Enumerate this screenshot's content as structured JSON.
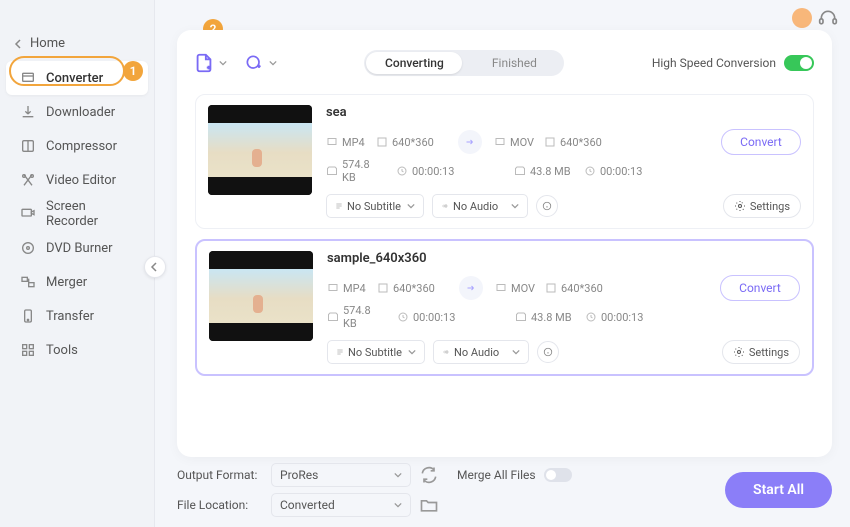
{
  "home_label": "Home",
  "sidebar": [
    {
      "label": "Converter",
      "active": true
    },
    {
      "label": "Downloader"
    },
    {
      "label": "Compressor"
    },
    {
      "label": "Video Editor"
    },
    {
      "label": "Screen Recorder"
    },
    {
      "label": "DVD Burner"
    },
    {
      "label": "Merger"
    },
    {
      "label": "Transfer"
    },
    {
      "label": "Tools"
    }
  ],
  "callout": {
    "one": "1",
    "two": "2"
  },
  "tabs": {
    "converting": "Converting",
    "finished": "Finished"
  },
  "hsc": {
    "label": "High Speed Conversion"
  },
  "convert_label": "Convert",
  "settings_label": "Settings",
  "sub_none": "No Subtitle",
  "aud_none": "No Audio",
  "items": [
    {
      "title": "sea",
      "src_ext": "MP4",
      "src_res": "640*360",
      "src_size": "574.8 KB",
      "src_dur": "00:00:13",
      "dst_ext": "MOV",
      "dst_res": "640*360",
      "dst_size": "43.8 MB",
      "dst_dur": "00:00:13"
    },
    {
      "title": "sample_640x360",
      "src_ext": "MP4",
      "src_res": "640*360",
      "src_size": "574.8 KB",
      "src_dur": "00:00:13",
      "dst_ext": "MOV",
      "dst_res": "640*360",
      "dst_size": "43.8 MB",
      "dst_dur": "00:00:13"
    }
  ],
  "footer": {
    "output_format_label": "Output Format:",
    "output_format_value": "ProRes",
    "file_location_label": "File Location:",
    "file_location_value": "Converted",
    "merge_label": "Merge All Files",
    "start_all": "Start All"
  }
}
